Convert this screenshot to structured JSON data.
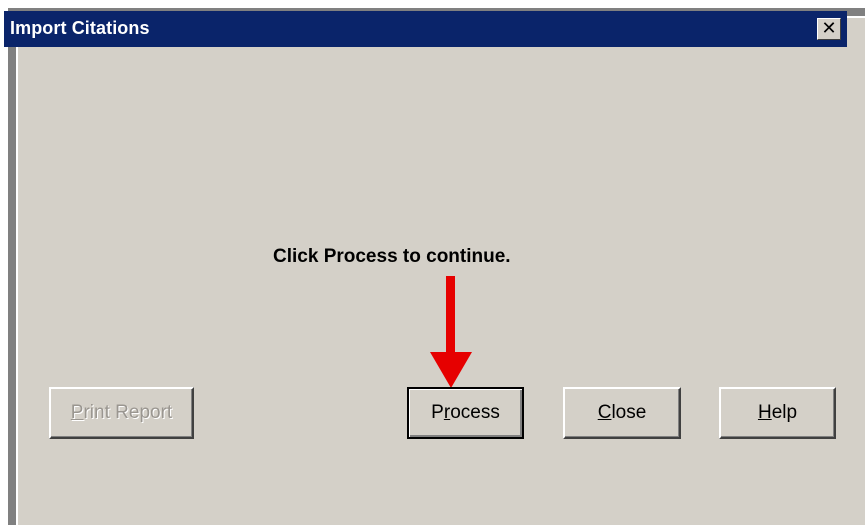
{
  "window": {
    "title": "Import Citations",
    "close_glyph": "✕"
  },
  "prompt": {
    "text": "Click Process to continue."
  },
  "buttons": {
    "print_report": {
      "mnemonic": "P",
      "rest": "rint Report",
      "enabled": false
    },
    "process": {
      "pre": "P",
      "mnemonic": "r",
      "rest": "ocess",
      "is_default": true
    },
    "close": {
      "mnemonic": "C",
      "rest": "lose"
    },
    "help": {
      "mnemonic": "H",
      "rest": "elp"
    }
  },
  "annotation": {
    "arrow_color": "#e60000",
    "arrow_target": "process-button"
  },
  "colors": {
    "titlebar": "#0a246a",
    "face": "#d4d0c8"
  }
}
